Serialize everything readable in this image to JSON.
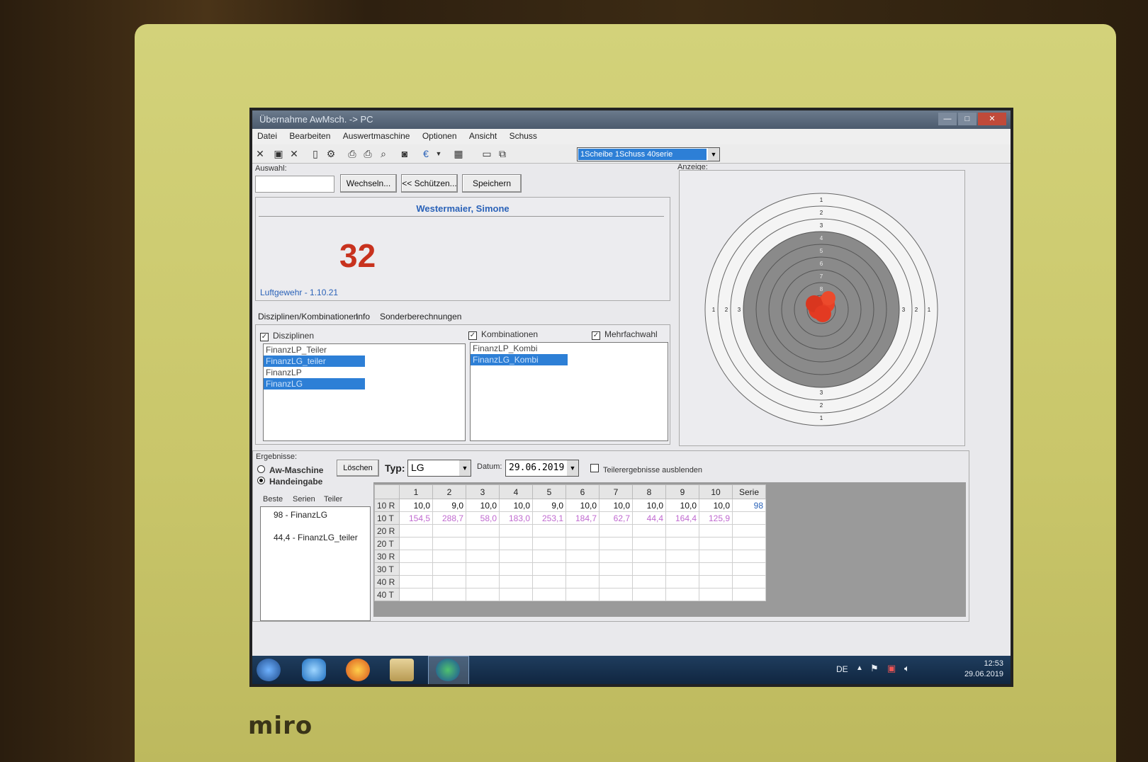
{
  "window": {
    "title": "Übernahme AwMsch. -> PC"
  },
  "menu": [
    "Datei",
    "Bearbeiten",
    "Auswertmaschine",
    "Optionen",
    "Ansicht",
    "Schuss"
  ],
  "toolbar": {
    "mode_select": "1Scheibe 1Schuss 40serie"
  },
  "auswahl": {
    "label": "Auswahl:",
    "wechseln": "Wechseln...",
    "schuetzen": "<< Schützen...",
    "speichern": "Speichern"
  },
  "shooter": {
    "name": "Westermaier, Simone",
    "score": "32",
    "discipline": "Luftgewehr - 1.10.21"
  },
  "tabs": [
    "Disziplinen/Kombinationen",
    "Info",
    "Sonderberechnungen"
  ],
  "disziplinen": {
    "label": "Disziplinen",
    "items": [
      "FinanzLP_Teiler",
      "FinanzLG_teiler",
      "FinanzLP",
      "FinanzLG"
    ]
  },
  "kombinationen": {
    "label": "Kombinationen",
    "mehrfach": "Mehrfachwahl",
    "items": [
      "FinanzLP_Kombi",
      "FinanzLG_Kombi"
    ]
  },
  "anzeige": {
    "label": "Anzeige:"
  },
  "ergebnisse": {
    "label": "Ergebnisse:",
    "aw_maschine": "Aw-Maschine",
    "handeingabe": "Handeingabe",
    "loeschen": "Löschen",
    "typ_label": "Typ:",
    "typ_value": "LG",
    "datum_label": "Datum:",
    "datum_value": "29.06.2019",
    "teiler_ausblenden": "Teilerergebnisse ausblenden",
    "subtabs": [
      "Beste",
      "Serien",
      "Teiler"
    ],
    "beste": [
      "98 - FinanzLG",
      "44,4 - FinanzLG_teiler"
    ]
  },
  "table": {
    "headers": [
      "1",
      "2",
      "3",
      "4",
      "5",
      "6",
      "7",
      "8",
      "9",
      "10",
      "Serie"
    ],
    "rows": [
      {
        "label": "10 R",
        "values": [
          "10,0",
          "9,0",
          "10,0",
          "10,0",
          "9,0",
          "10,0",
          "10,0",
          "10,0",
          "10,0",
          "10,0"
        ],
        "serie": "98"
      },
      {
        "label": "10 T",
        "values": [
          "154,5",
          "288,7",
          "58,0",
          "183,0",
          "253,1",
          "184,7",
          "62,7",
          "44,4",
          "164,4",
          "125,9"
        ],
        "serie": ""
      },
      {
        "label": "20 R",
        "values": [],
        "serie": ""
      },
      {
        "label": "20 T",
        "values": [],
        "serie": ""
      },
      {
        "label": "30 R",
        "values": [],
        "serie": ""
      },
      {
        "label": "30 T",
        "values": [],
        "serie": ""
      },
      {
        "label": "40 R",
        "values": [],
        "serie": ""
      },
      {
        "label": "40 T",
        "values": [],
        "serie": ""
      }
    ]
  },
  "taskbar": {
    "lang": "DE",
    "time": "12:53",
    "date": "29.06.2019"
  },
  "monitor": {
    "brand": "miro"
  },
  "target_rings": [
    "1",
    "2",
    "3",
    "4",
    "5",
    "6",
    "7",
    "8",
    "9"
  ]
}
